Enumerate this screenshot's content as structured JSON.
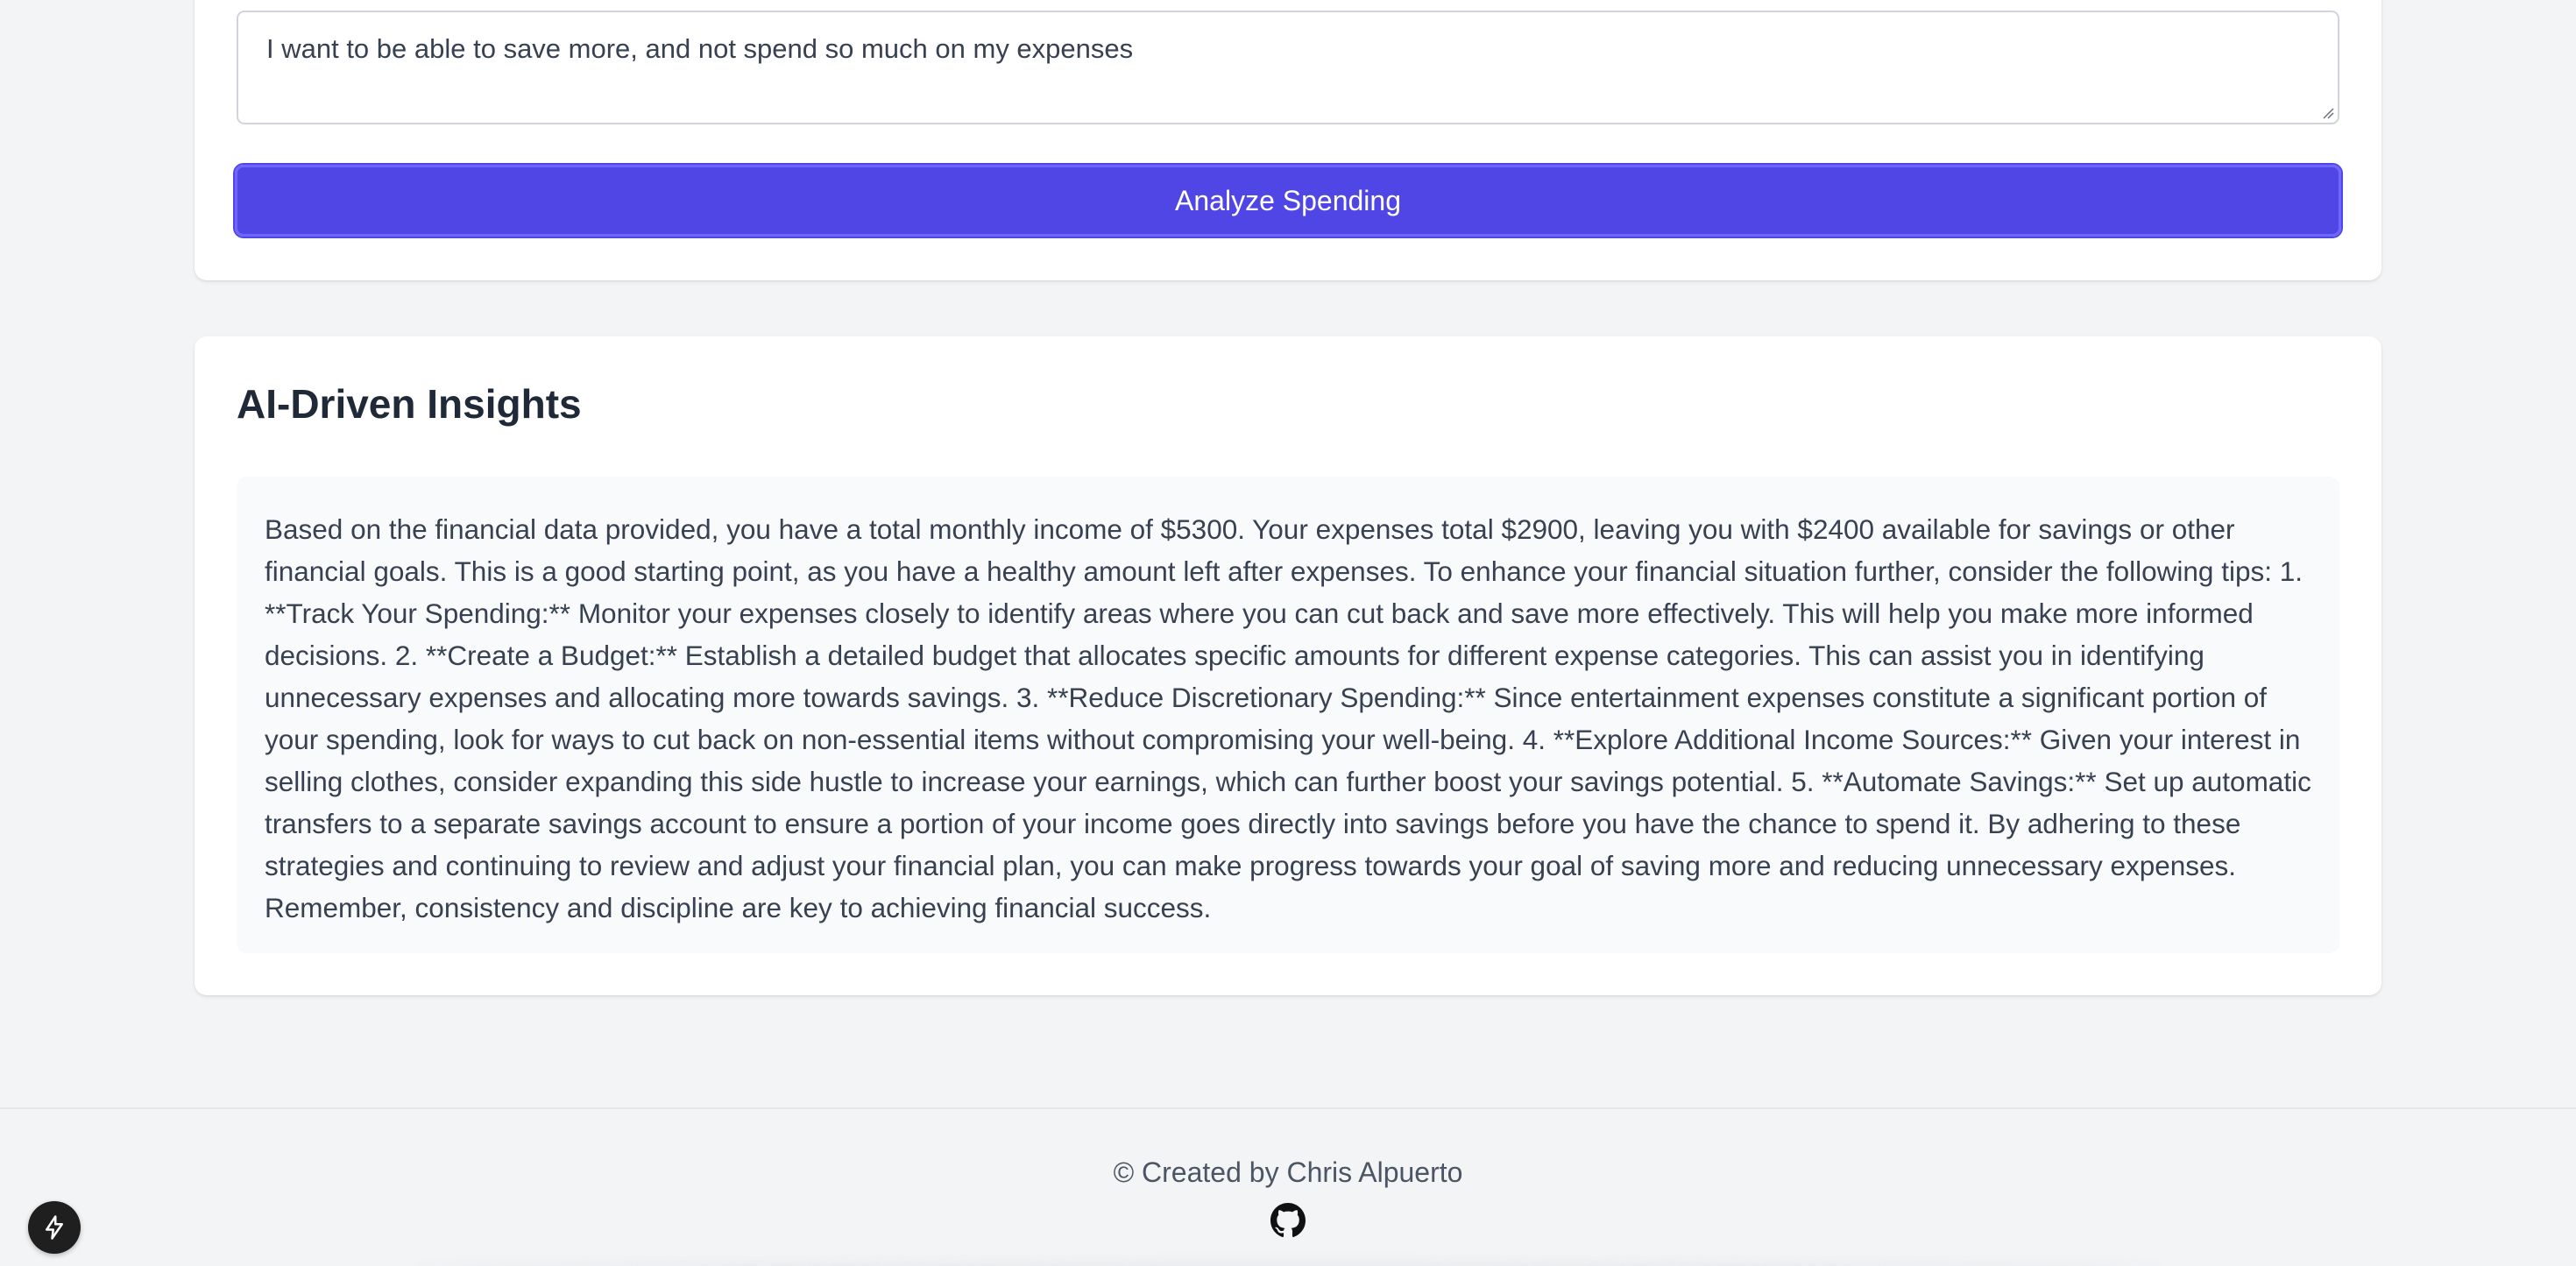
{
  "form": {
    "goal_text": "I want to be able to save more, and not spend so much on my expenses",
    "analyze_button_label": "Analyze Spending"
  },
  "insights": {
    "title": "AI-Driven Insights",
    "body": "Based on the financial data provided, you have a total monthly income of $5300. Your expenses total $2900, leaving you with $2400 available for savings or other financial goals. This is a good starting point, as you have a healthy amount left after expenses. To enhance your financial situation further, consider the following tips: 1. **Track Your Spending:** Monitor your expenses closely to identify areas where you can cut back and save more effectively. This will help you make more informed decisions. 2. **Create a Budget:** Establish a detailed budget that allocates specific amounts for different expense categories. This can assist you in identifying unnecessary expenses and allocating more towards savings. 3. **Reduce Discretionary Spending:** Since entertainment expenses constitute a significant portion of your spending, look for ways to cut back on non-essential items without compromising your well-being. 4. **Explore Additional Income Sources:** Given your interest in selling clothes, consider expanding this side hustle to increase your earnings, which can further boost your savings potential. 5. **Automate Savings:** Set up automatic transfers to a separate savings account to ensure a portion of your income goes directly into savings before you have the chance to spend it. By adhering to these strategies and continuing to review and adjust your financial plan, you can make progress towards your goal of saving more and reducing unnecessary expenses. Remember, consistency and discipline are key to achieving financial success."
  },
  "footer": {
    "credit": "© Created by Chris Alpuerto",
    "github_icon": "github-icon"
  },
  "fab": {
    "icon": "lightning-bolt-icon"
  },
  "colors": {
    "accent": "#4f46e5",
    "background": "#f3f4f6",
    "card": "#ffffff",
    "insights_box": "#f9fafb"
  }
}
